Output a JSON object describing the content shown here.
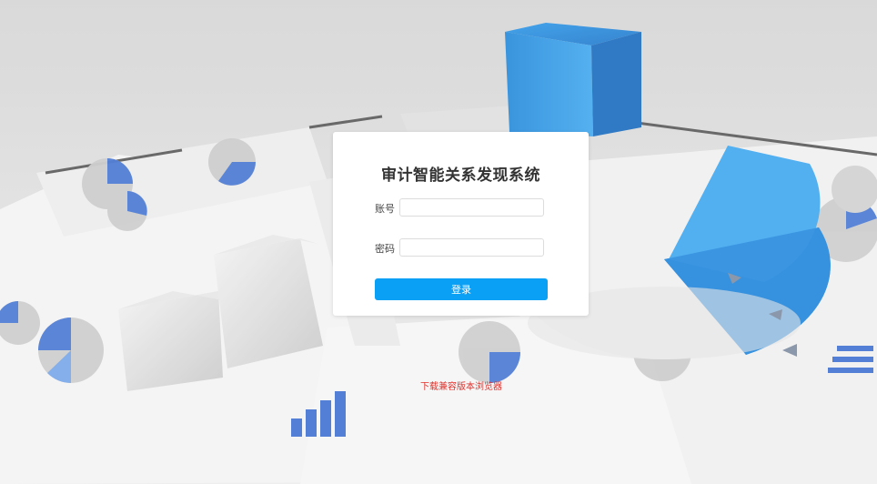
{
  "login": {
    "title": "审计智能关系发现系统",
    "account_label": "账号",
    "account_value": "",
    "password_label": "密码",
    "password_value": "",
    "submit_label": "登录",
    "accent_color": "#0aa0f6"
  },
  "footer": {
    "download_link": "下载兼容版本浏览器",
    "link_color": "#e0302a"
  },
  "background": {
    "description_icon": "3d-charts-background"
  }
}
